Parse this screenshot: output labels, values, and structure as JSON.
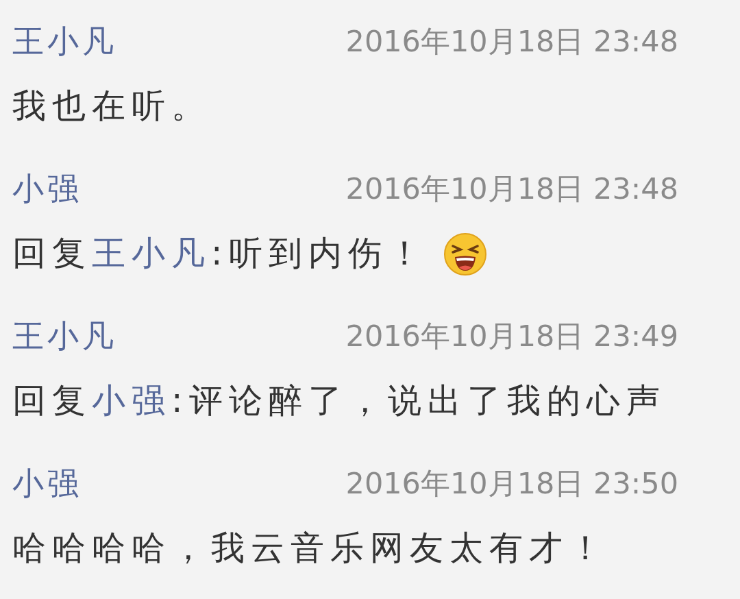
{
  "comments": [
    {
      "author": "王小凡",
      "time": "2016年10月18日 23:48",
      "text": "我也在听。",
      "emoji": false
    },
    {
      "author": "小强",
      "time": "2016年10月18日 23:48",
      "prefix": "回复",
      "reply_to": "王小凡",
      "text": ":听到内伤！",
      "emoji": true
    },
    {
      "author": "王小凡",
      "time": "2016年10月18日 23:49",
      "prefix": "回复",
      "reply_to": "小强",
      "text": ":评论醉了，说出了我的心声",
      "emoji": false
    },
    {
      "author": "小强",
      "time": "2016年10月18日 23:50",
      "text": "哈哈哈哈，我云音乐网友太有才！",
      "emoji": false
    }
  ]
}
